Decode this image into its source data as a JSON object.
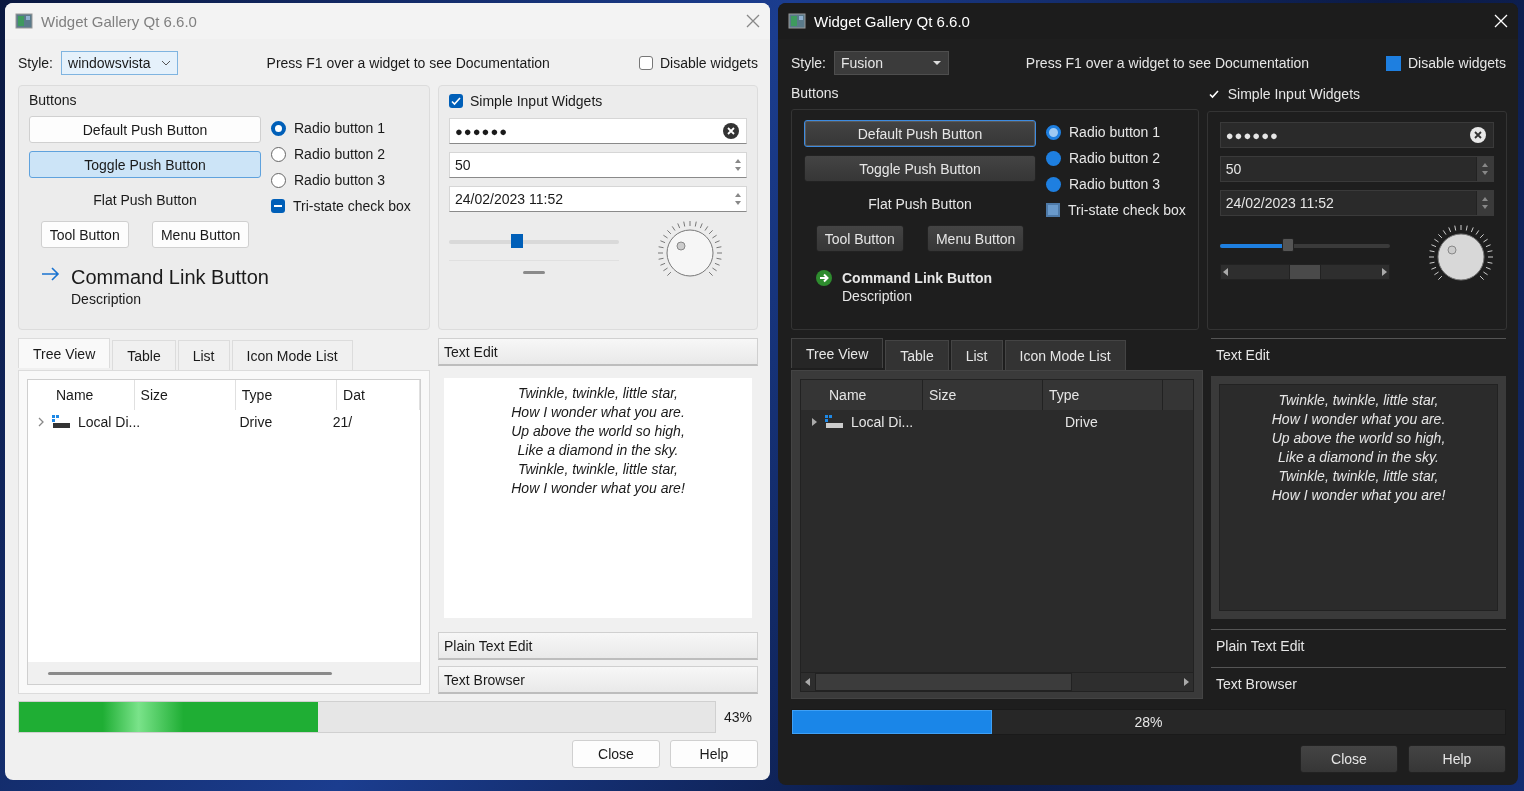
{
  "windows": [
    {
      "kind": "light",
      "title": "Widget Gallery Qt 6.6.0",
      "style_label": "Style:",
      "style_value": "windowsvista",
      "hint": "Press F1 over a widget to see Documentation",
      "disable_widgets": {
        "label": "Disable widgets",
        "checked": false
      },
      "buttons_group": {
        "title": "Buttons",
        "default_button": "Default Push Button",
        "toggle_button": {
          "label": "Toggle Push Button",
          "selected": true
        },
        "flat_button": "Flat Push Button",
        "tool_button": "Tool Button",
        "menu_button": "Menu Button",
        "command_link": {
          "label": "Command Link Button",
          "description": "Description"
        },
        "radios": [
          {
            "label": "Radio button 1",
            "selected": true
          },
          {
            "label": "Radio button 2",
            "selected": false
          },
          {
            "label": "Radio button 3",
            "selected": false
          }
        ],
        "tristate": {
          "label": "Tri-state check box",
          "partially_checked": true
        }
      },
      "inputs_group": {
        "title": "Simple Input Widgets",
        "checked": true,
        "password": "●●●●●●",
        "spin_value": "50",
        "datetime": "24/02/2023 11:52",
        "slider": {
          "level": 0.4
        }
      },
      "tabs": [
        {
          "label": "Tree View",
          "selected": true
        },
        {
          "label": "Table",
          "selected": false
        },
        {
          "label": "List",
          "selected": false
        },
        {
          "label": "Icon Mode List",
          "selected": false
        }
      ],
      "tree": {
        "columns": [
          "Name",
          "Size",
          "Type",
          "Dat"
        ],
        "rows": [
          {
            "cells": [
              "Local Di...",
              "",
              "Drive",
              "21/"
            ],
            "expanded": false
          }
        ]
      },
      "toolbox": [
        {
          "label": "Text Edit",
          "expanded": true
        },
        {
          "label": "Plain Text Edit",
          "expanded": false
        },
        {
          "label": "Text Browser",
          "expanded": false
        }
      ],
      "text_edit_lines": [
        "Twinkle, twinkle, little star,",
        "How I wonder what you are.",
        "Up above the world so high,",
        "Like a diamond in the sky.",
        "Twinkle, twinkle, little star,",
        "How I wonder what you are!"
      ],
      "progress": {
        "level": 0.43,
        "label": "43%"
      },
      "dialog_buttons": [
        "Close",
        "Help"
      ]
    },
    {
      "kind": "dark",
      "title": "Widget Gallery Qt 6.6.0",
      "style_label": "Style:",
      "style_value": "Fusion",
      "hint": "Press F1 over a widget to see Documentation",
      "disable_widgets": {
        "label": "Disable widgets",
        "checked": false
      },
      "buttons_group": {
        "title": "Buttons",
        "default_button": "Default Push Button",
        "toggle_button": {
          "label": "Toggle Push Button",
          "selected": false
        },
        "flat_button": "Flat Push Button",
        "tool_button": "Tool Button",
        "menu_button": "Menu Button",
        "command_link": {
          "label": "Command Link Button",
          "description": "Description"
        },
        "radios": [
          {
            "label": "Radio button 1",
            "selected": true
          },
          {
            "label": "Radio button 2",
            "selected": false
          },
          {
            "label": "Radio button 3",
            "selected": false
          }
        ],
        "tristate": {
          "label": "Tri-state check box",
          "partially_checked": true
        }
      },
      "inputs_group": {
        "title": "Simple Input Widgets",
        "checked": true,
        "password": "●●●●●●",
        "spin_value": "50",
        "datetime": "24/02/2023 11:52",
        "slider": {
          "level": 0.4
        }
      },
      "tabs": [
        {
          "label": "Tree View",
          "selected": true
        },
        {
          "label": "Table",
          "selected": false
        },
        {
          "label": "List",
          "selected": false
        },
        {
          "label": "Icon Mode List",
          "selected": false
        }
      ],
      "tree": {
        "columns": [
          "Name",
          "Size",
          "Type"
        ],
        "rows": [
          {
            "cells": [
              "Local Di...",
              "",
              "Drive"
            ],
            "expanded": false
          }
        ]
      },
      "toolbox": [
        {
          "label": "Text Edit",
          "expanded": true
        },
        {
          "label": "Plain Text Edit",
          "expanded": false
        },
        {
          "label": "Text Browser",
          "expanded": false
        }
      ],
      "text_edit_lines": [
        "Twinkle, twinkle, little star,",
        "How I wonder what you are.",
        "Up above the world so high,",
        "Like a diamond in the sky.",
        "Twinkle, twinkle, little star,",
        "How I wonder what you are!"
      ],
      "progress": {
        "level": 0.28,
        "label": "28%"
      },
      "dialog_buttons": [
        "Close",
        "Help"
      ]
    }
  ]
}
